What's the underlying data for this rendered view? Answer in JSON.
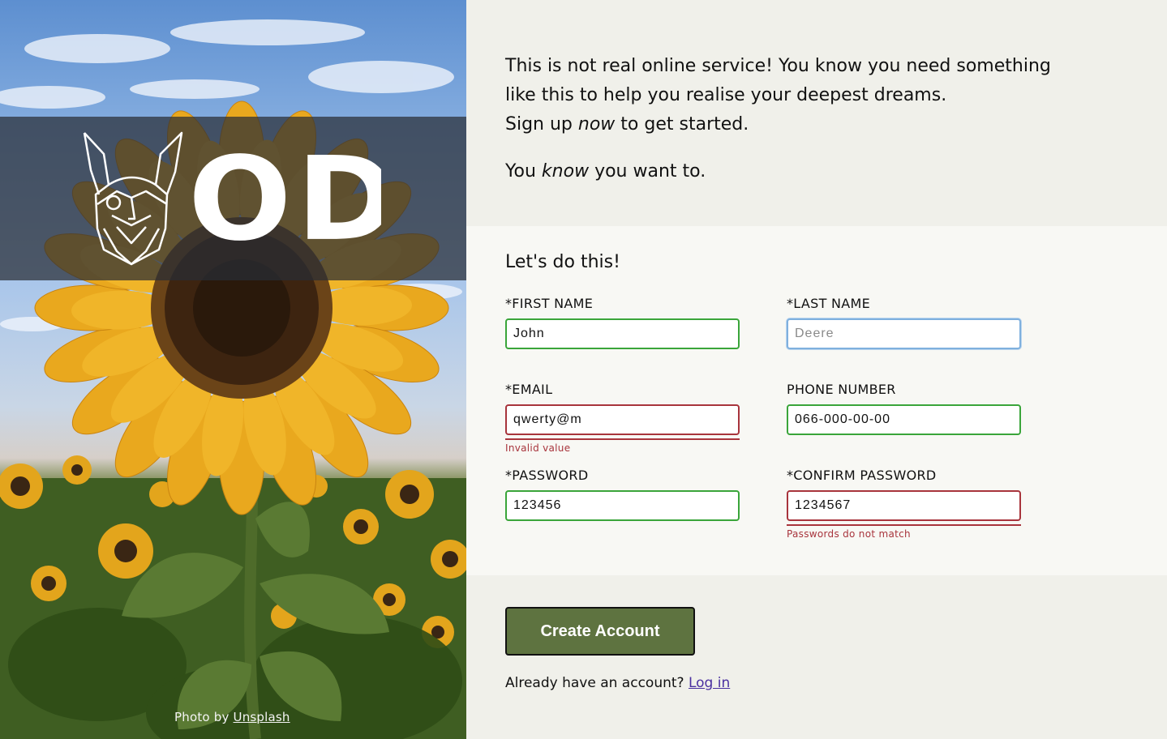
{
  "hero": {
    "brand": "ODIN",
    "photo_credit_prefix": "Photo by",
    "photo_credit_link": "Unsplash"
  },
  "intro": {
    "line1": "This is not real online service! You know you need something",
    "line2": "like this to help you realise your deepest dreams.",
    "line3_before": "Sign up",
    "line3_emph": "now",
    "line3_after": "to get started.",
    "line4_before": "You",
    "line4_emph": "know",
    "line4_after": "you want to."
  },
  "form": {
    "title": "Let's do this!",
    "first_name": {
      "label": "*FIRST NAME",
      "value": "John"
    },
    "last_name": {
      "label": "*LAST NAME",
      "value": "",
      "placeholder": "Deere"
    },
    "email": {
      "label": "*EMAIL",
      "value": "qwerty@m",
      "error": "Invalid value"
    },
    "phone": {
      "label": "PHONE NUMBER",
      "value": "066-000-00-00"
    },
    "password": {
      "label": "*PASSWORD",
      "value": "123456"
    },
    "confirm_password": {
      "label": "*CONFIRM PASSWORD",
      "value": "1234567",
      "error": "Passwords do not match"
    }
  },
  "actions": {
    "create_label": "Create Account",
    "login_prompt": "Already have an account?",
    "login_link": "Log in"
  },
  "colors": {
    "valid_border": "#3aa53a",
    "invalid_border": "#a8343c",
    "focus_border": "#7fb0de",
    "button_bg": "#5e7340",
    "panel_light": "#f8f8f4",
    "panel_dark": "#f0f0ea"
  }
}
